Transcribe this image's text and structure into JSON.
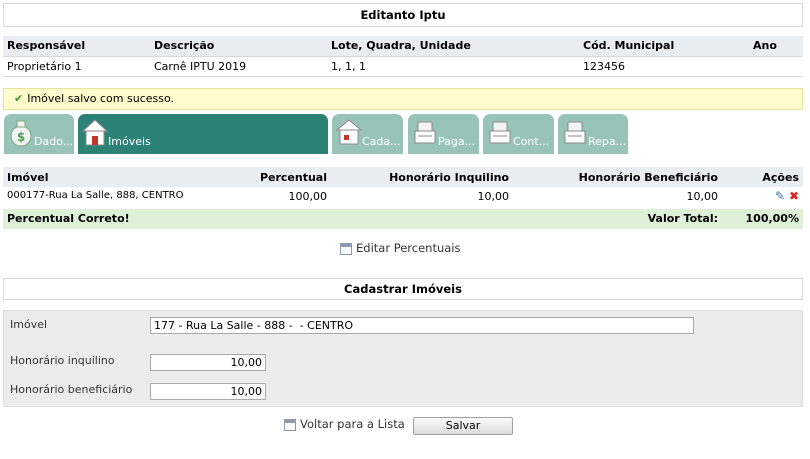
{
  "header": {
    "title": "Editanto Iptu"
  },
  "info": {
    "columns": [
      "Responsável",
      "Descrição",
      "Lote, Quadra, Unidade",
      "Cód. Municipal",
      "Ano"
    ],
    "row": [
      "Proprietário 1",
      "Carnê IPTU 2019",
      "1, 1, 1",
      "123456",
      ""
    ]
  },
  "message": {
    "text": "Imóvel salvo com sucesso."
  },
  "tabs": [
    {
      "label": "Dado...",
      "icon": "money-bag-icon"
    },
    {
      "label": "Imóveis",
      "icon": "house-icon"
    },
    {
      "label": "Cada...",
      "icon": "register-house-icon"
    },
    {
      "label": "Paga...",
      "icon": "cash-register-icon"
    },
    {
      "label": "Cont...",
      "icon": "cash-register-icon"
    },
    {
      "label": "Repa...",
      "icon": "cash-register-icon"
    }
  ],
  "grid": {
    "columns": [
      "Imóvel",
      "Percentual",
      "Honorário Inquilino",
      "Honorário Beneficiário",
      "Ações"
    ],
    "rows": [
      {
        "imovel": "000177-Rua La Salle, 888, CENTRO",
        "percentual": "100,00",
        "hon_inquilino": "10,00",
        "hon_beneficiario": "10,00"
      }
    ],
    "footer": {
      "status": "Percentual Correto!",
      "total_label": "Valor Total:",
      "total_value": "100,00%"
    }
  },
  "edit_percentuais": "Editar Percentuais",
  "form": {
    "title": "Cadastrar Imóveis",
    "imovel_label": "Imóvel",
    "imovel_value": "177 - Rua La Salle - 888 -  - CENTRO",
    "hon_inquilino_label": "Honorário inquilino",
    "hon_inquilino_value": "10,00",
    "hon_beneficiario_label": "Honorário beneficiário",
    "hon_beneficiario_value": "10,00"
  },
  "actions": {
    "back_label": "Voltar para a Lista",
    "save_label": "Salvar"
  },
  "colors": {
    "tab_active": "#2d8276",
    "tab_inactive": "#98c4b7",
    "success_bg": "#dff0d8",
    "message_bg": "#fffbcc"
  }
}
